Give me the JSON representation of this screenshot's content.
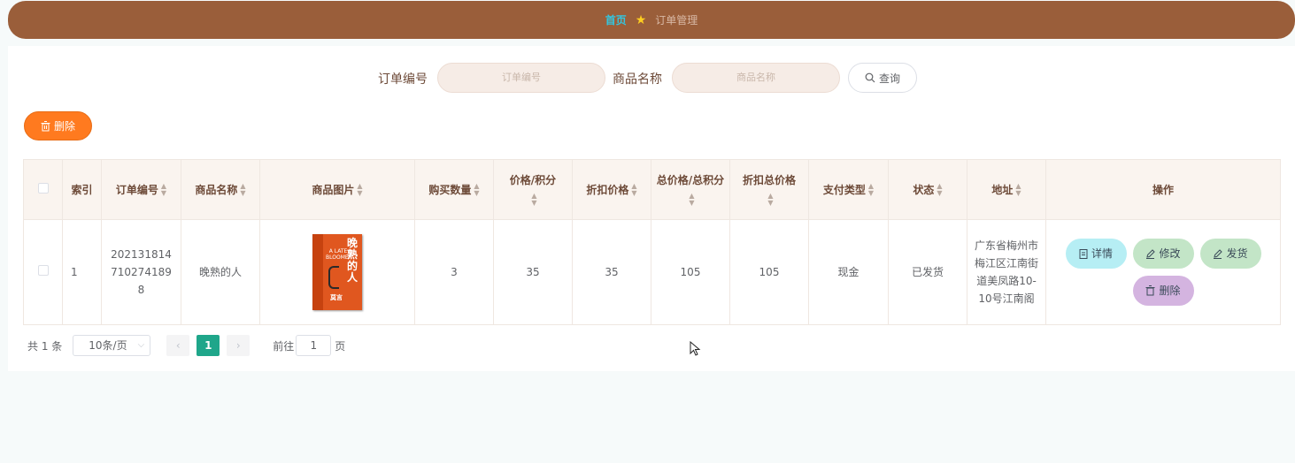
{
  "breadcrumb": {
    "home": "首页",
    "separator_icon": "star-icon",
    "current": "订单管理"
  },
  "search": {
    "order_no_label": "订单编号",
    "order_no_placeholder": "订单编号",
    "product_label": "商品名称",
    "product_placeholder": "商品名称",
    "query_label": "查询"
  },
  "toolbar": {
    "delete_label": "删除"
  },
  "table": {
    "headers": {
      "index": "索引",
      "order_no": "订单编号",
      "product_name": "商品名称",
      "product_image": "商品图片",
      "quantity": "购买数量",
      "price": "价格/积分",
      "discount_price": "折扣价格",
      "total": "总价格/总积分",
      "discount_total": "折扣总价格",
      "pay_type": "支付类型",
      "status": "状态",
      "address": "地址",
      "actions": "操作"
    },
    "rows": [
      {
        "index": "1",
        "order_no": "2021318147102741898",
        "product_name": "晚熟的人",
        "book_title": "晚熟的人",
        "book_subtitle": "A LATE BLOOMER",
        "book_author": "莫言",
        "quantity": "3",
        "price": "35",
        "discount_price": "35",
        "total": "105",
        "discount_total": "105",
        "pay_type": "现金",
        "status": "已发货",
        "address": "广东省梅州市梅江区江南街道美凤路10-10号江南阁"
      }
    ],
    "actions": {
      "detail": "详情",
      "edit": "修改",
      "ship": "发货",
      "delete": "删除"
    }
  },
  "pagination": {
    "total_text": "共 1 条",
    "page_size": "10条/页",
    "current_page": "1",
    "goto_label": "前往",
    "goto_value": "1",
    "page_unit": "页"
  },
  "colors": {
    "header_bar": "#9a5e3a",
    "delete_button": "#ff7a1f",
    "active_page": "#1fa68a"
  }
}
